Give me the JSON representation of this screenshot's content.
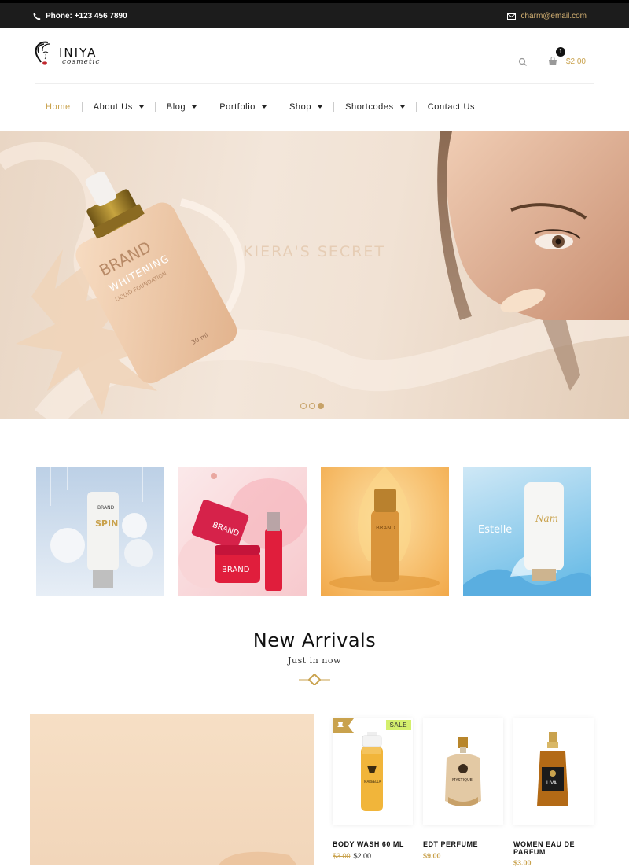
{
  "topbar": {
    "phone": "Phone: +123 456 7890",
    "email": "charm@email.com"
  },
  "logo": {
    "name": "INIYA",
    "tagline": "cosmetic"
  },
  "header": {
    "cart_count": "1",
    "cart_total": "$2.00"
  },
  "nav": {
    "items": [
      {
        "label": "Home",
        "active": true,
        "dropdown": false
      },
      {
        "label": "About Us",
        "dropdown": true
      },
      {
        "label": "Blog",
        "dropdown": true
      },
      {
        "label": "Portfolio",
        "dropdown": true
      },
      {
        "label": "Shop",
        "dropdown": true
      },
      {
        "label": "Shortcodes",
        "dropdown": true
      },
      {
        "label": "Contact Us",
        "dropdown": false
      }
    ]
  },
  "hero": {
    "title": "KIERA'S SECRET",
    "bottle_brand": "BRAND",
    "bottle_line1": "WHITENING",
    "bottle_line2": "LIQUID FOUNDATION",
    "bottle_volume": "30 ml",
    "active_slide": 3,
    "slide_count": 3
  },
  "tiles": [
    {
      "name": "BRAND",
      "label": "SPIN"
    },
    {
      "name": "BRAND",
      "label": "BRAND"
    },
    {
      "name": "BRAND",
      "label": ""
    },
    {
      "name": "Estelle",
      "label": ""
    }
  ],
  "section": {
    "title": "New Arrivals",
    "subtitle": "Just in now"
  },
  "products": [
    {
      "name": "BODY WASH 60 ML",
      "old_price": "$3.00",
      "price": "$2.00",
      "badge": "SALE"
    },
    {
      "name": "EDT PERFUME",
      "price": "$9.00"
    },
    {
      "name": "WOMEN EAU DE PARFUM",
      "price": "$3.00"
    }
  ],
  "colors": {
    "accent": "#c9a24d",
    "topbar": "#1c1c1c",
    "sale": "#d4ef6d"
  }
}
